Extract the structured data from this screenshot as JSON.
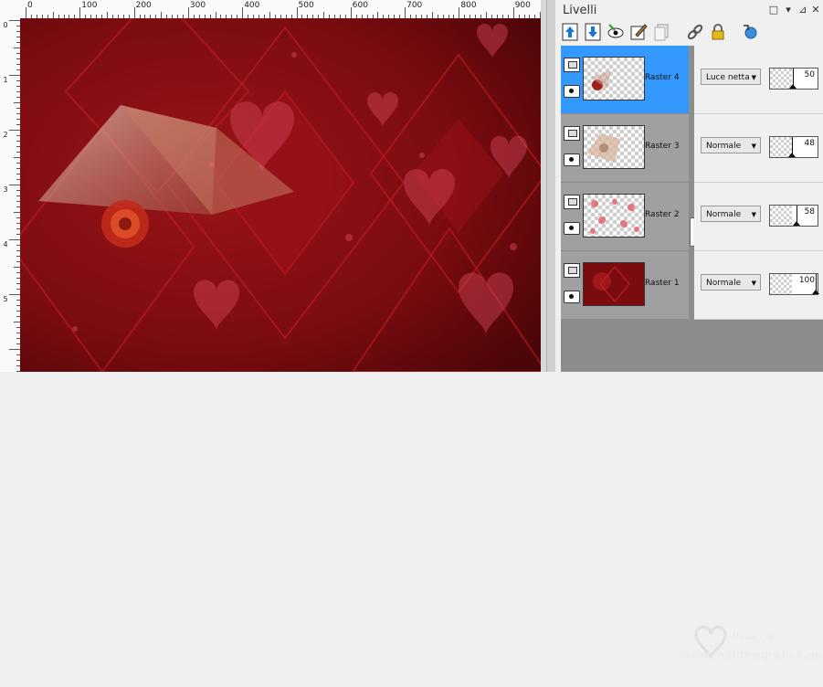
{
  "ruler": {
    "top_labels": [
      "0",
      "100",
      "200",
      "300",
      "400",
      "500",
      "600",
      "700",
      "800",
      "900"
    ],
    "left_labels": [
      "0",
      "1",
      "2",
      "3",
      "4",
      "5"
    ]
  },
  "palette": {
    "title": "Livelli",
    "window_buttons": [
      "□",
      "▾",
      "⊿",
      "✕"
    ]
  },
  "toolbar": {
    "icons": [
      "move-up-layer-icon",
      "move-down-layer-icon",
      "visibility-toggle-icon",
      "edit-layer-icon",
      "duplicate-layer-icon",
      "link-layers-icon",
      "lock-layer-icon",
      "refresh-layer-icon"
    ]
  },
  "layers": [
    {
      "name": "Raster 4",
      "blend": "Luce netta",
      "opacity": "50",
      "selected": true,
      "thumb": "raster4"
    },
    {
      "name": "Raster 3",
      "blend": "Normale",
      "opacity": "48",
      "selected": false,
      "thumb": "raster3"
    },
    {
      "name": "Raster 2",
      "blend": "Normale",
      "opacity": "58",
      "selected": false,
      "thumb": "raster2"
    },
    {
      "name": "Raster 1",
      "blend": "Normale",
      "opacity": "100",
      "selected": false,
      "thumb": "raster1"
    }
  ],
  "watermark": {
    "line1": "Pinuccia",
    "line2": "www.maidiregrafica.eu"
  },
  "colors": {
    "selection": "#3399ff",
    "canvas_base": "#6e0a0e",
    "layer_list_bg": "#a0a0a0"
  }
}
